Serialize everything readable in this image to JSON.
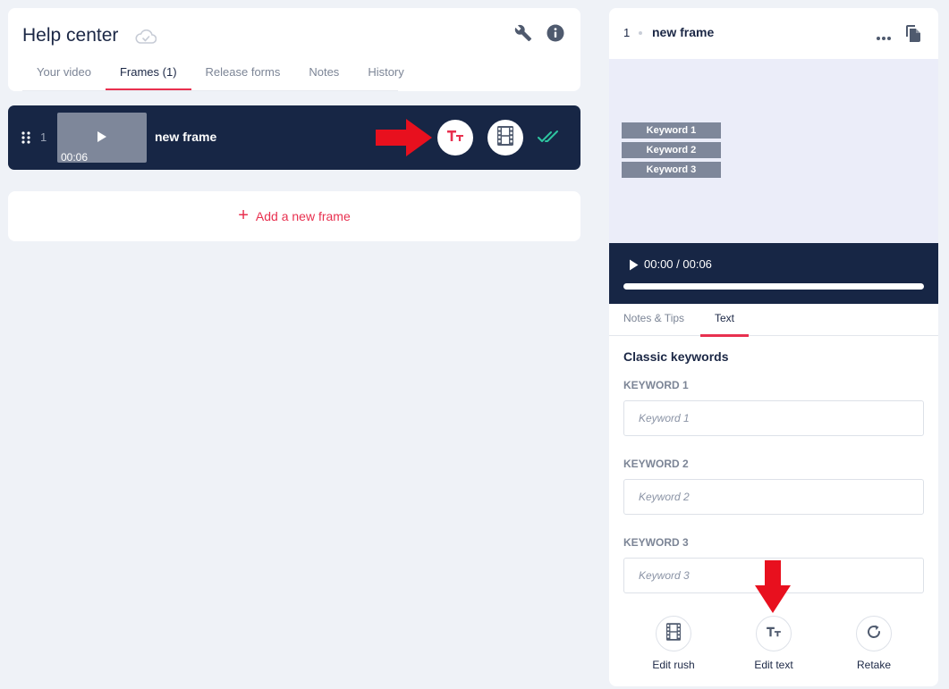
{
  "header": {
    "title": "Help center",
    "tabs": [
      {
        "label": "Your video",
        "active": false
      },
      {
        "label": "Frames (1)",
        "active": true
      },
      {
        "label": "Release forms",
        "active": false
      },
      {
        "label": "Notes",
        "active": false
      },
      {
        "label": "History",
        "active": false
      }
    ],
    "icons": [
      "cloud-check-icon",
      "wrench-icon",
      "info-icon"
    ]
  },
  "frame_row": {
    "index": "1",
    "duration": "00:06",
    "name": "new frame",
    "icons": [
      "drag-handle-icon",
      "play-icon",
      "text-icon",
      "film-icon",
      "double-check-icon"
    ]
  },
  "add_frame": {
    "label": "Add a new frame",
    "icon": "plus-icon"
  },
  "right_panel": {
    "index": "1",
    "name": "new frame",
    "preview_keywords": [
      "Keyword 1",
      "Keyword 2",
      "Keyword 3"
    ],
    "player": {
      "time": "00:00 / 00:06",
      "progress": 0
    },
    "sub_tabs": [
      {
        "label": "Notes & Tips",
        "active": false
      },
      {
        "label": "Text",
        "active": true
      }
    ],
    "section_title": "Classic keywords",
    "keywords": [
      {
        "label": "KEYWORD 1",
        "placeholder": "Keyword 1",
        "value": ""
      },
      {
        "label": "KEYWORD 2",
        "placeholder": "Keyword 2",
        "value": ""
      },
      {
        "label": "KEYWORD 3",
        "placeholder": "Keyword 3",
        "value": ""
      }
    ],
    "actions": [
      {
        "label": "Edit rush",
        "icon": "film-icon"
      },
      {
        "label": "Edit text",
        "icon": "text-icon"
      },
      {
        "label": "Retake",
        "icon": "retake-icon"
      }
    ]
  },
  "colors": {
    "accent": "#e8304f",
    "navy": "#172645",
    "annotation_arrow": "#e8101e",
    "success": "#2ec4a0"
  }
}
